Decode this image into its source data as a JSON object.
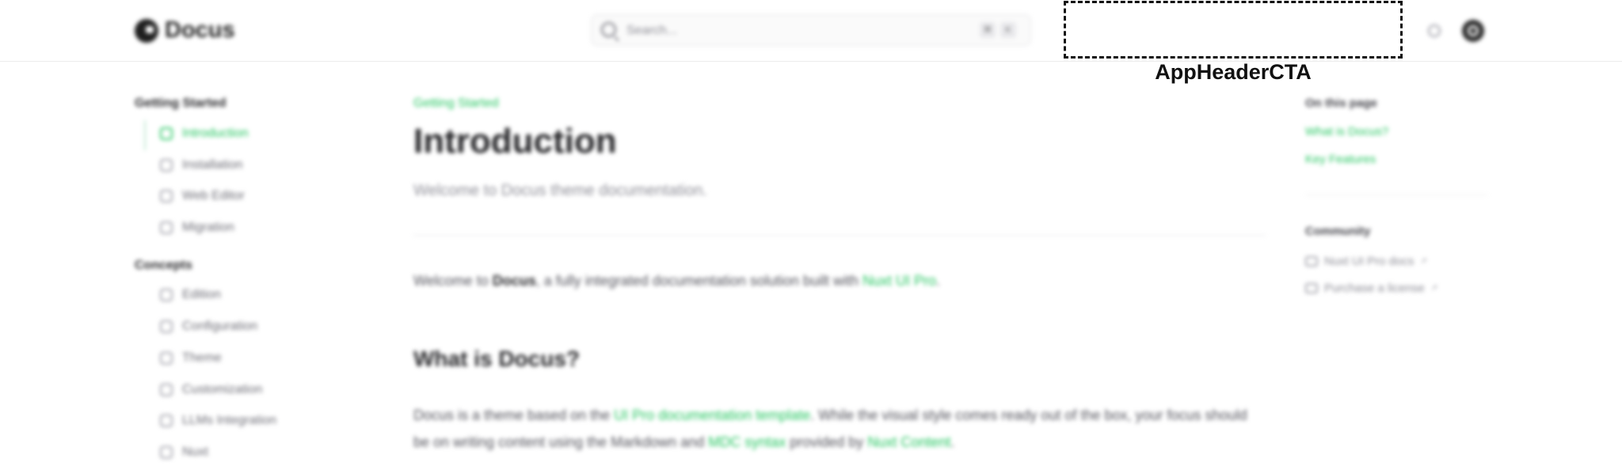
{
  "header": {
    "logo_text": "Docus",
    "search_placeholder": "Search...",
    "kbd_1": "⌘",
    "kbd_2": "K",
    "cta_label": "AppHeaderCTA"
  },
  "sidebar": {
    "sections": [
      {
        "heading": "Getting Started",
        "items": [
          {
            "label": "Introduction",
            "icon": "house-icon",
            "active": true
          },
          {
            "label": "Installation",
            "icon": "download-icon"
          },
          {
            "label": "Web Editor",
            "icon": "cursor-icon"
          },
          {
            "label": "Migration",
            "icon": "route-icon"
          }
        ]
      },
      {
        "heading": "Concepts",
        "items": [
          {
            "label": "Edition",
            "icon": "pencil-icon"
          },
          {
            "label": "Configuration",
            "icon": "cog-icon"
          },
          {
            "label": "Theme",
            "icon": "paint-roller-icon"
          },
          {
            "label": "Customization",
            "icon": "brush-icon"
          },
          {
            "label": "LLMs Integration",
            "icon": "message-icon"
          },
          {
            "label": "Nuxt",
            "icon": "nuxt-icon"
          }
        ]
      }
    ]
  },
  "main": {
    "breadcrumb": "Getting Started",
    "title": "Introduction",
    "description": "Welcome to Docus theme documentation.",
    "intro": {
      "prefix": "Welcome to ",
      "bold": "Docus",
      "middle": ", a fully integrated documentation solution built with ",
      "link": "Nuxt UI Pro",
      "suffix": "."
    },
    "section_title": "What is Docus?",
    "body": {
      "t1": "Docus is a theme based on the ",
      "l1": "UI Pro documentation template",
      "t2": ". While the visual style comes ready out of the box, your focus should be on writing content using the Markdown and ",
      "l2": "MDC syntax",
      "t3": " provided by ",
      "l3": "Nuxt Content",
      "t4": "."
    }
  },
  "toc": {
    "heading": "On this page",
    "links": [
      "What is Docus?",
      "Key Features"
    ],
    "community_heading": "Community",
    "community_links": [
      "Nuxt UI Pro docs",
      "Purchase a license"
    ],
    "external_mark": "↗"
  },
  "colors": {
    "accent": "#22c55e",
    "text": "#27272a",
    "muted": "#8a8a93"
  }
}
